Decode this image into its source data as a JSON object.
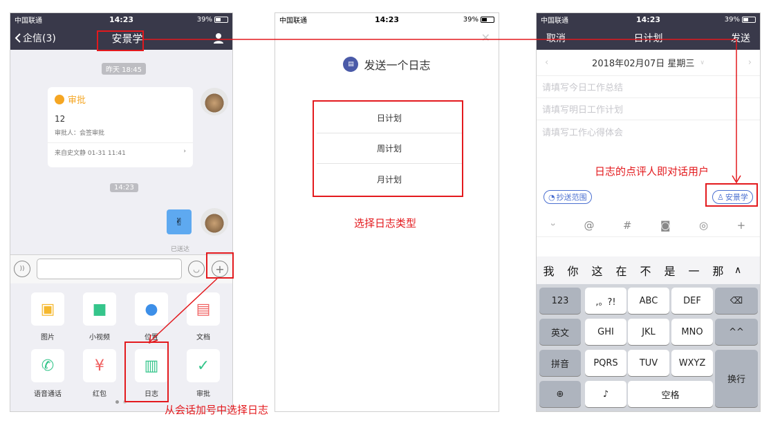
{
  "status": {
    "carrier": "中国联通",
    "time": "14:23",
    "battery": "39%"
  },
  "chat": {
    "back": "企信(3)",
    "title": "安景学",
    "ts1": "昨天 18:45",
    "card": {
      "title": "审批",
      "content": "12",
      "approver": "审批人：会签审批",
      "source": "来自史文静 01-31 11:41"
    },
    "ts2": "14:23",
    "sent": "已送达",
    "grid": [
      {
        "label": "图片",
        "icon": "image-icon",
        "color": "#f5b82e"
      },
      {
        "label": "小视频",
        "icon": "video-icon",
        "color": "#35c58b"
      },
      {
        "label": "位置",
        "icon": "location-icon",
        "color": "#3d8fe8"
      },
      {
        "label": "文档",
        "icon": "document-icon",
        "color": "#f06060"
      },
      {
        "label": "语音通话",
        "icon": "phone-icon",
        "color": "#35c58b"
      },
      {
        "label": "红包",
        "icon": "red-packet-icon",
        "color": "#f06060"
      },
      {
        "label": "日志",
        "icon": "journal-icon",
        "color": "#35c58b"
      },
      {
        "label": "审批",
        "icon": "approval-icon",
        "color": "#35c58b"
      }
    ]
  },
  "sheet": {
    "title": "发送一个日志",
    "options": [
      "日计划",
      "周计划",
      "月计划"
    ]
  },
  "plan": {
    "cancel": "取消",
    "title": "日计划",
    "send": "发送",
    "date": "2018年02月07日 星期三",
    "fields": [
      "请填写今日工作总结",
      "请填写明日工作计划",
      "请填写工作心得体会"
    ],
    "cc": "抄送范围",
    "reviewer": "安景学",
    "toolbar": [
      "smile-icon",
      "at-icon",
      "hash-icon",
      "camera-icon",
      "location-icon",
      "plus-icon"
    ],
    "candidates": [
      "我",
      "你",
      "这",
      "在",
      "不",
      "是",
      "一",
      "那"
    ],
    "keys": {
      "num": "123",
      "punct": ",。?!",
      "abc": "ABC",
      "def": "DEF",
      "en": "英文",
      "ghi": "GHI",
      "jkl": "JKL",
      "mno": "MNO",
      "face": "^^",
      "py": "拼音",
      "pqrs": "PQRS",
      "tuv": "TUV",
      "wxyz": "WXYZ",
      "enter": "换行",
      "space": "空格"
    }
  },
  "annotations": {
    "a1": "选择日志类型",
    "a2": "日志的点评人即对话用户",
    "a3": "从会话加号中选择日志"
  },
  "colors": {
    "accent": "#e3191d",
    "nav": "#39394a",
    "primary": "#4a6fd0"
  }
}
